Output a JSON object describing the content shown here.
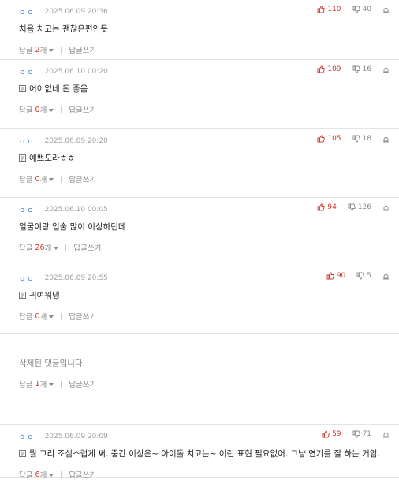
{
  "labels": {
    "reply": "답글",
    "reply_unit": "개",
    "write_reply": "답글쓰기"
  },
  "comments": [
    {
      "nick": "ㅇㅇ",
      "date": "2025.06.09 20:36",
      "up": "110",
      "down": "40",
      "text": "처음 치고는 괜찮은편인듯",
      "has_image_icon": false,
      "replies": "2"
    },
    {
      "nick": "ㅇㅇ",
      "date": "2025.06.10 00:20",
      "up": "109",
      "down": "16",
      "text": "어이없네 돈 좋음",
      "has_image_icon": true,
      "replies": "0"
    },
    {
      "nick": "ㅇㅇ",
      "date": "2025.06.09 20:20",
      "up": "105",
      "down": "18",
      "text": "예쁘도라ㅎㅎ",
      "has_image_icon": true,
      "replies": "0"
    },
    {
      "nick": "ㅇㅇ",
      "date": "2025.06.10 00:05",
      "up": "94",
      "down": "126",
      "text": "얼굴이랑 입술 많이 이상하던데",
      "has_image_icon": false,
      "replies": "26"
    },
    {
      "nick": "ㅇㅇ",
      "date": "2025.06.09 20:55",
      "up": "90",
      "down": "5",
      "text": "귀여워냉",
      "has_image_icon": true,
      "replies": "0"
    },
    {
      "deleted": true,
      "text": "삭제된 댓글입니다.",
      "replies": "1"
    },
    {
      "nick": "ㅇㅇ",
      "date": "2025.06.09 20:09",
      "up": "59",
      "down": "71",
      "text": "뭘 그리 조심스럽게 써. 중간 이상은~ 아이돌 치고는~ 이런 표현 필요없어. 그냥 연기를 잘 하는 거임.",
      "has_image_icon": true,
      "replies": "6"
    }
  ],
  "colors": {
    "accent_red": "#d0342c",
    "nick_blue": "#3a7ad9",
    "muted": "#888888"
  }
}
